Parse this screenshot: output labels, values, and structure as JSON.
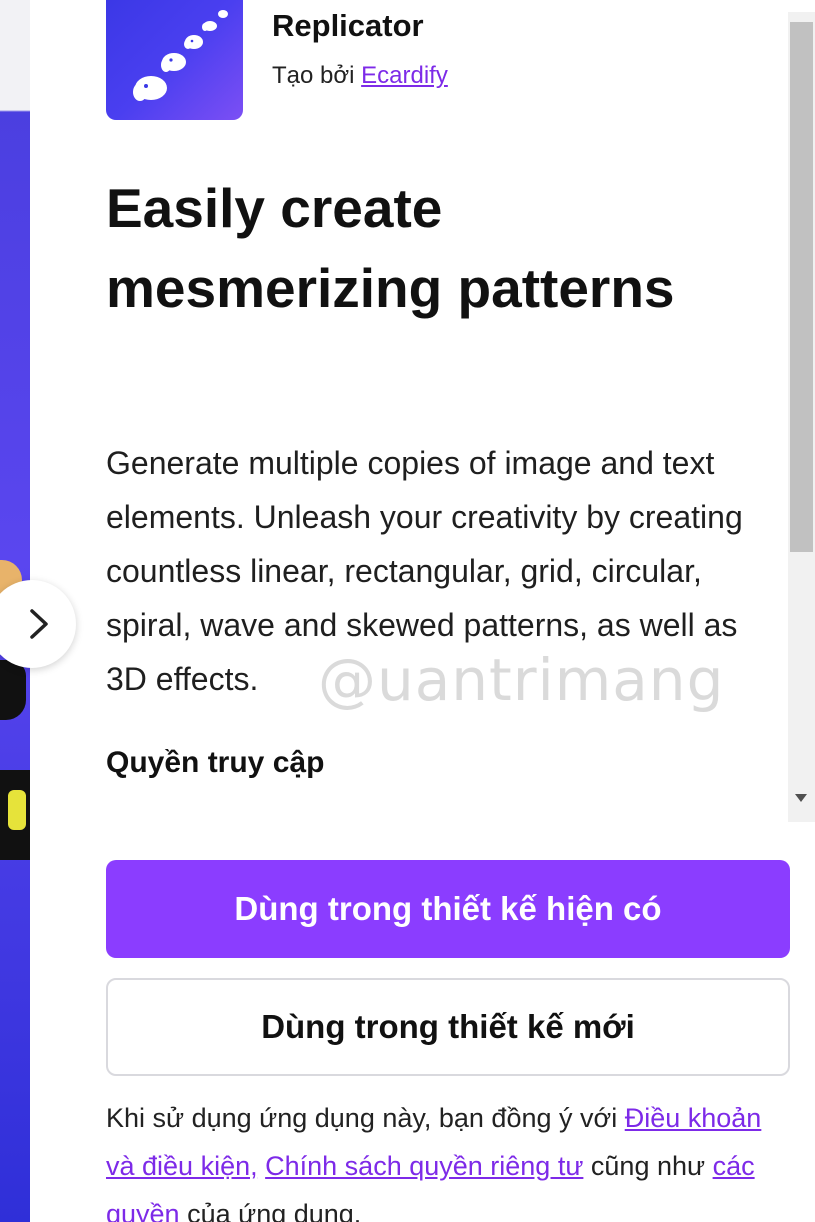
{
  "app": {
    "name": "Replicator",
    "by_prefix": "Tạo bởi",
    "developer": "Ecardify"
  },
  "headline": "Easily create mesmerizing patterns",
  "description": "Generate multiple copies of image and text elements. Unleash your creativity by creating countless linear, rectangular, grid, circular, spiral, wave and skewed patterns, as well as 3D effects.",
  "permissions_heading": "Quyền truy cập",
  "buttons": {
    "use_existing": "Dùng trong thiết kế hiện có",
    "use_new": "Dùng trong thiết kế mới"
  },
  "terms": {
    "prefix": "Khi sử dụng ứng dụng này, bạn đồng ý với",
    "link_terms": "Điều khoản và điều kiện,",
    "link_privacy": "Chính sách quyền riêng tư",
    "middle": "cũng như",
    "link_permissions": "các quyền",
    "suffix": "của ứng dụng."
  },
  "watermark": "@uantrimang",
  "colors": {
    "primary": "#8b3dff",
    "link": "#7d2ae8",
    "icon_gradient_start": "#3b38e6",
    "icon_gradient_end": "#7c4ff4"
  },
  "icons": {
    "nav": "chevron-right-icon",
    "app": "elephant-pattern-icon",
    "scroll": "triangle-down-icon"
  }
}
